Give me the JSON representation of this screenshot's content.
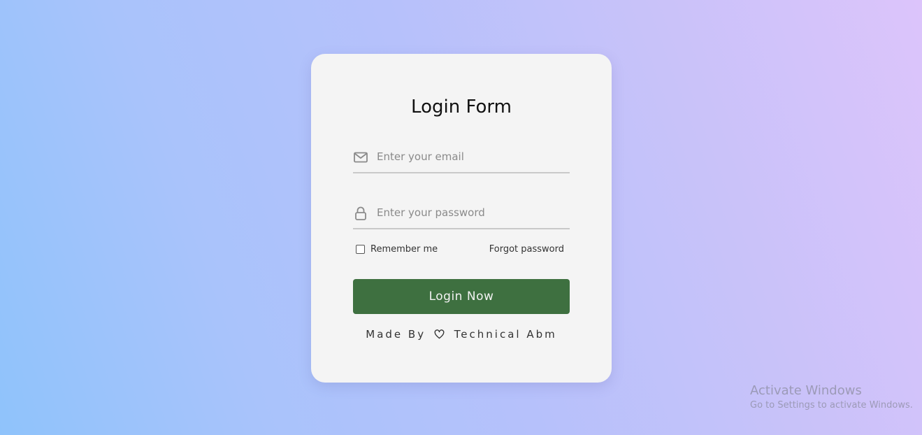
{
  "form": {
    "title": "Login Form",
    "email": {
      "placeholder": "Enter your email",
      "value": "",
      "icon": "envelope-icon"
    },
    "password": {
      "placeholder": "Enter your password",
      "value": "",
      "icon": "lock-icon"
    },
    "remember_label": "Remember me",
    "remember_checked": false,
    "forgot_label": "Forgot password",
    "login_label": "Login Now",
    "login_button_color": "#3e7040",
    "footer": {
      "prefix": "Made By",
      "heart_icon": "heart-icon",
      "author": "Technical Abm"
    }
  },
  "watermark": {
    "title": "Activate Windows",
    "subtitle": "Go to Settings to activate Windows."
  },
  "colors": {
    "card_background": "#f4f4f4",
    "gradient_start": "#8fc3fb",
    "gradient_end": "#dcc4fb"
  }
}
